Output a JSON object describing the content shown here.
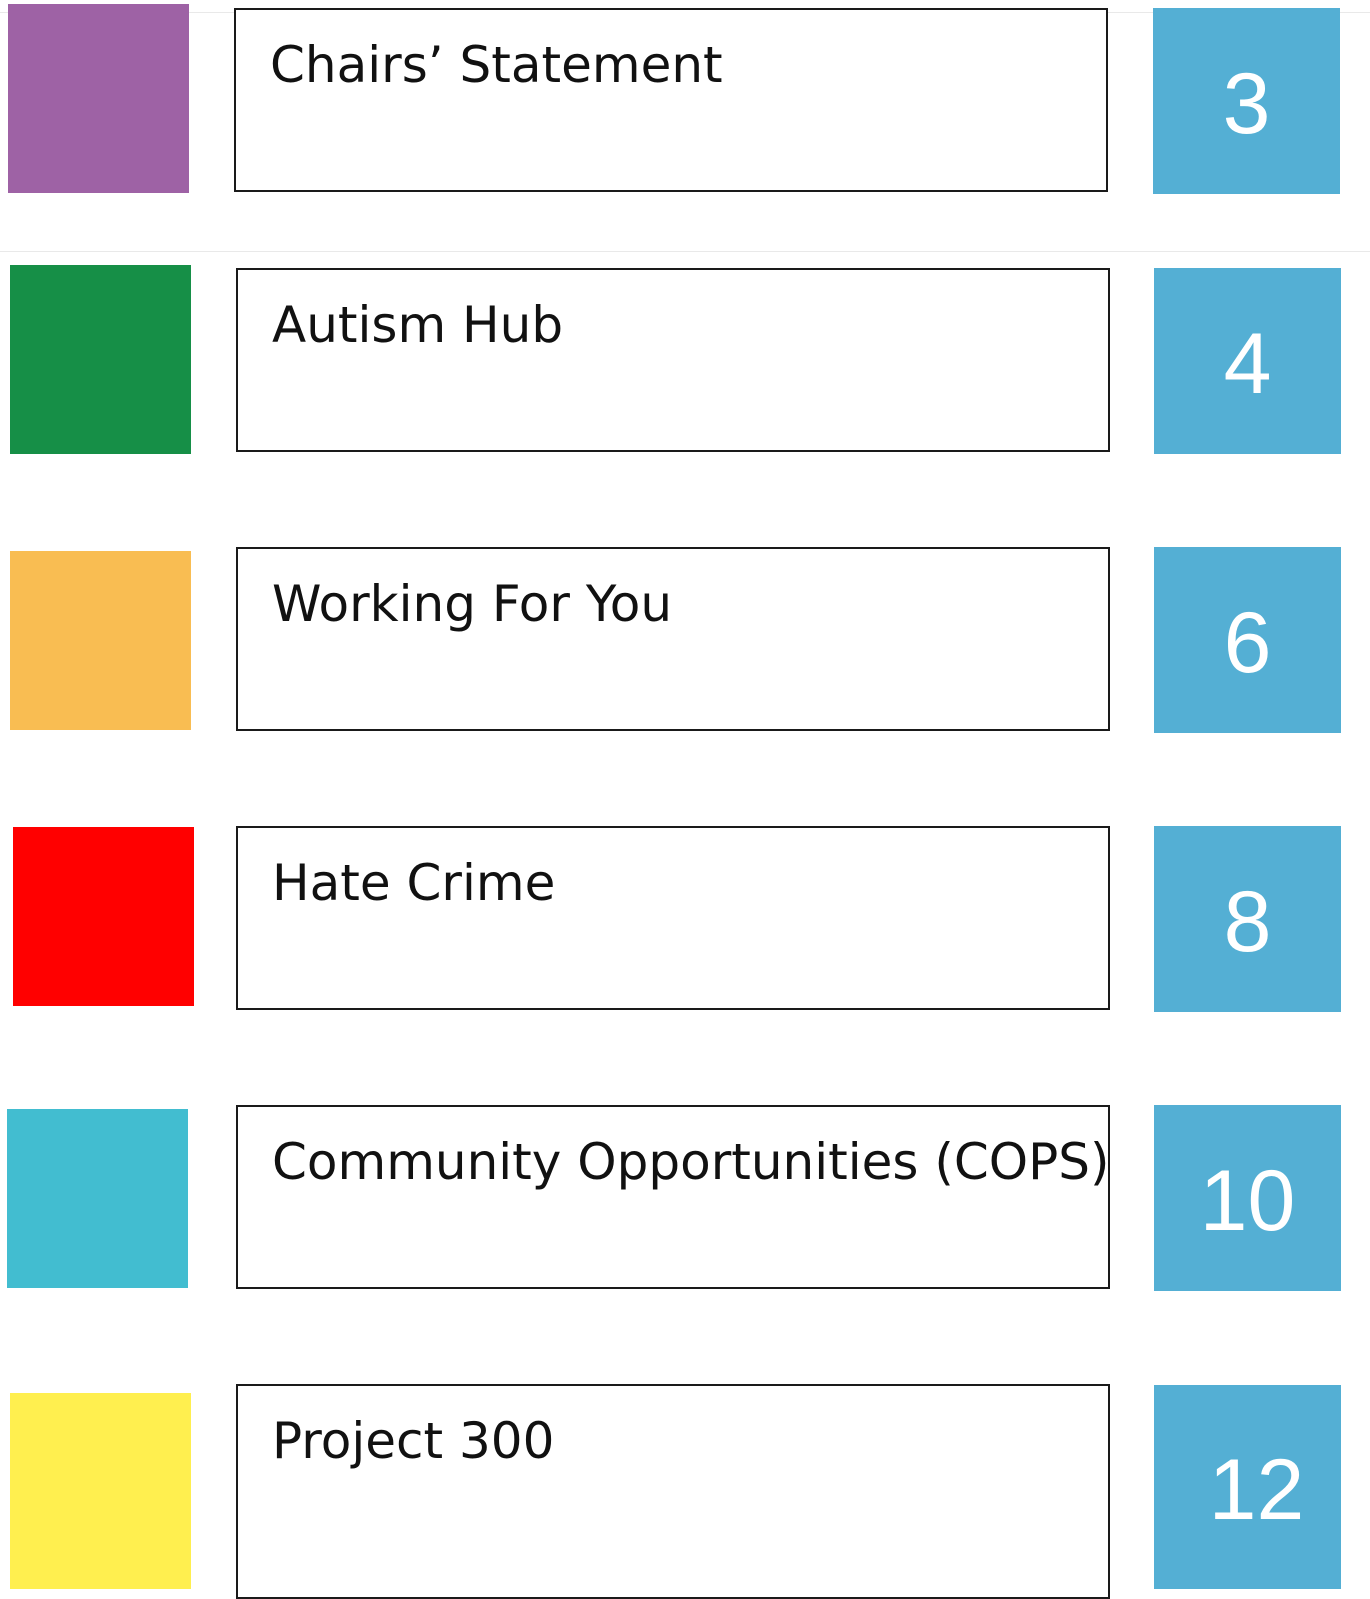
{
  "colors": {
    "page_number_background": "#54afd4",
    "box_border": "#1a1a1a"
  },
  "contents": [
    {
      "title": "Chairs’ Statement",
      "page": "3",
      "swatch_color": "#9e62a5"
    },
    {
      "title": "Autism Hub",
      "page": "4",
      "swatch_color": "#168f47"
    },
    {
      "title": "Working For You",
      "page": "6",
      "swatch_color": "#f9bd52"
    },
    {
      "title": "Hate Crime",
      "page": "8",
      "swatch_color": "#ff0000"
    },
    {
      "title": "Community Opportunities (COPS)",
      "page": "10",
      "swatch_color": "#42bdd0"
    },
    {
      "title": "Project 300",
      "page": "12",
      "swatch_color": "#ffef4f"
    }
  ]
}
